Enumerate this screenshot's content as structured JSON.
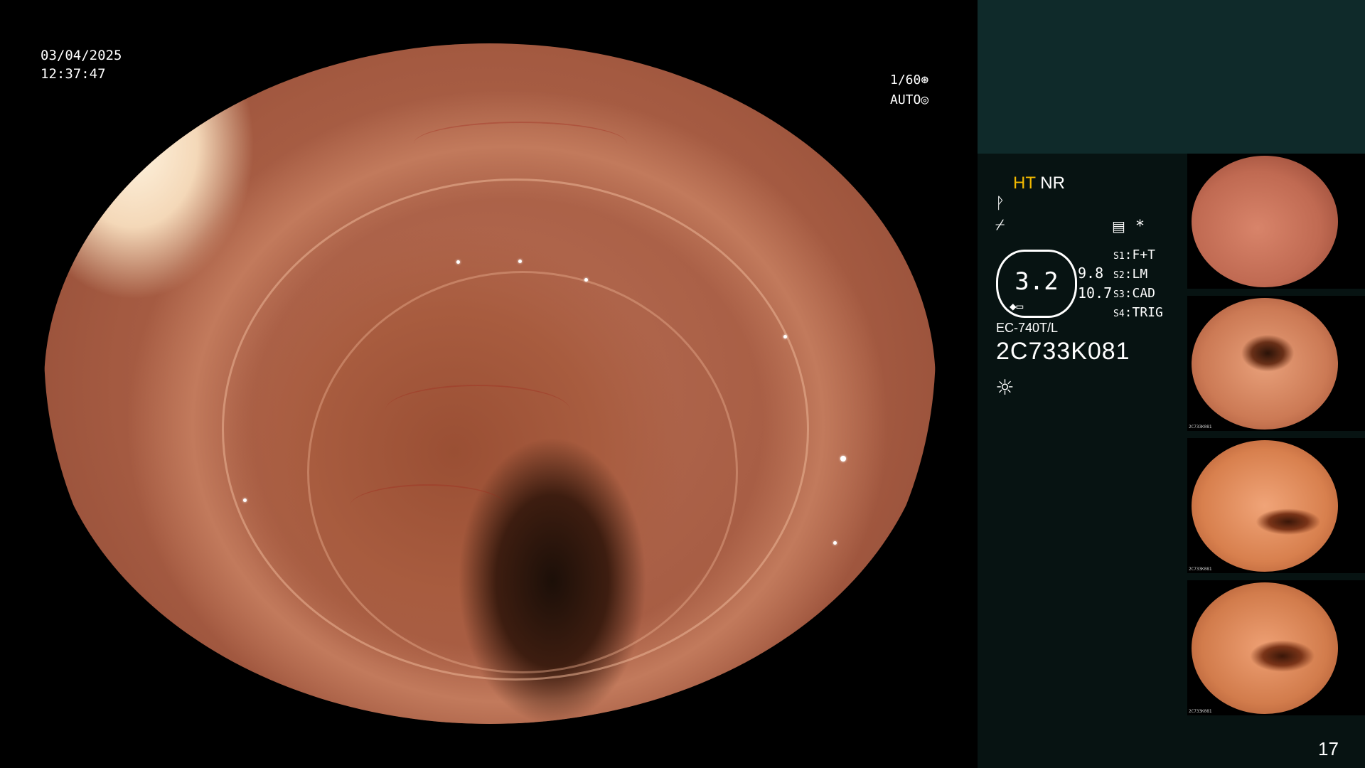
{
  "overlay": {
    "date": "03/04/2025",
    "time": "12:37:47",
    "shutter": "1/60",
    "exposure_mode": "AUTO"
  },
  "panel": {
    "mode_ht": "HT",
    "mode_nr": "NR",
    "gauge_value": "3.2",
    "gauge_side_top": "9.8",
    "gauge_side_bottom": "10.7",
    "switches": [
      {
        "key": "S1",
        "value": "F+T"
      },
      {
        "key": "S2",
        "value": "LM"
      },
      {
        "key": "S3",
        "value": "CAD"
      },
      {
        "key": "S4",
        "value": "TRIG"
      }
    ],
    "asterisk": "*",
    "scope_model": "EC-740T/L",
    "scope_serial": "2C733K081",
    "thumbnail_caption": "2C733K081",
    "page_number": "17"
  },
  "icons": {
    "shutter": "aperture-icon",
    "auto": "exposure-icon",
    "curve1": "curve-icon",
    "curve2": "curve-slash-icon",
    "memory": "memory-icon",
    "light": "light-icon"
  }
}
